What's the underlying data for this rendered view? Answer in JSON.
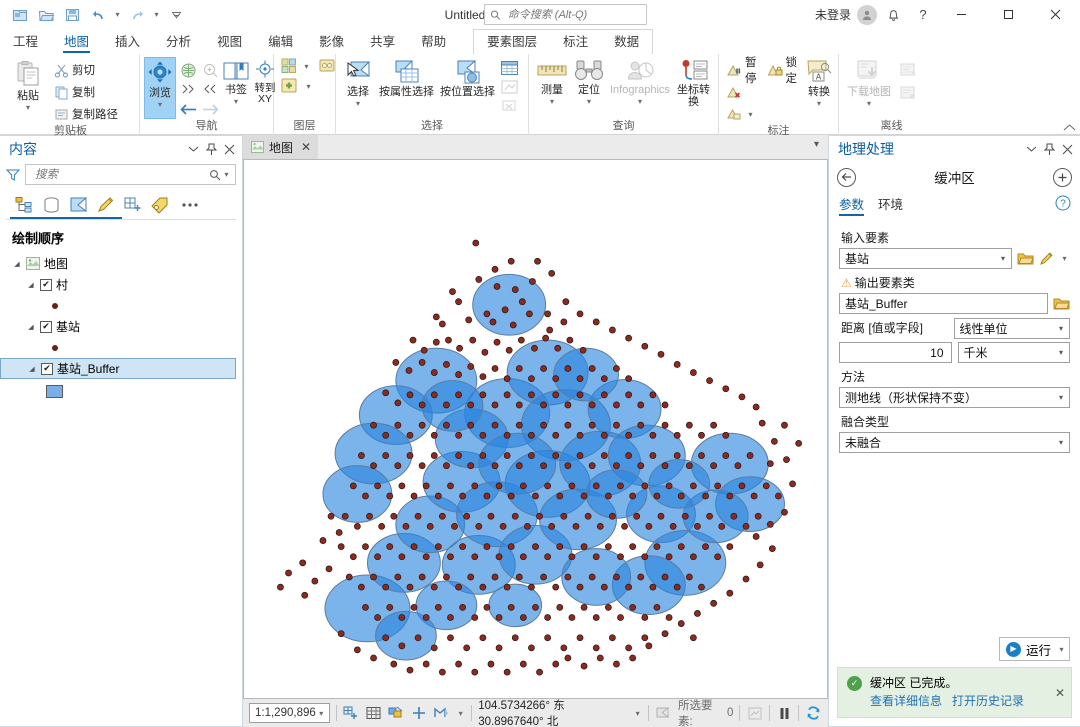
{
  "titlebar": {
    "title": "Untitled",
    "search_placeholder": "命令搜索 (Alt-Q)",
    "sign_in": "未登录",
    "qat": [
      {
        "name": "new-project-icon",
        "label": "新建"
      },
      {
        "name": "open-project-icon",
        "label": "打开"
      },
      {
        "name": "save-project-icon",
        "label": "保存"
      },
      {
        "name": "undo-icon",
        "label": "撤销"
      },
      {
        "name": "redo-icon",
        "label": "重做"
      },
      {
        "name": "customize-qat-icon",
        "label": "自定义快速访问工具栏"
      }
    ],
    "window_buttons": {
      "minimize": "—",
      "maximize": "▢",
      "close": "✕"
    },
    "help": "?"
  },
  "ribbon": {
    "tabs": [
      {
        "label": "工程",
        "active": false
      },
      {
        "label": "地图",
        "active": true
      },
      {
        "label": "插入",
        "active": false
      },
      {
        "label": "分析",
        "active": false
      },
      {
        "label": "视图",
        "active": false
      },
      {
        "label": "编辑",
        "active": false
      },
      {
        "label": "影像",
        "active": false
      },
      {
        "label": "共享",
        "active": false
      },
      {
        "label": "帮助",
        "active": false
      }
    ],
    "contextual_tabs": [
      {
        "label": "要素图层"
      },
      {
        "label": "标注"
      },
      {
        "label": "数据"
      }
    ],
    "groups": {
      "clipboard": {
        "label": "剪贴板",
        "paste": "粘贴",
        "cut": "剪切",
        "copy": "复制",
        "copy_path": "复制路径"
      },
      "navigate": {
        "label": "导航",
        "explore": "浏览",
        "bookmarks": "书签",
        "goto_xy": "转到\nXY",
        "goto_xy_line1": "转到",
        "goto_xy_line2": "XY"
      },
      "layer": {
        "label": "图层"
      },
      "selection": {
        "label": "选择",
        "select": "选择",
        "select_by_attributes": "按属性选择",
        "select_by_location": "按位置选择"
      },
      "inquiry": {
        "label": "查询",
        "measure": "测量",
        "locate": "定位",
        "infographics": "Infographics",
        "coordinate_conversion": "坐标转换"
      },
      "labeling": {
        "label": "标注",
        "pause": "暂停",
        "lock": "锁定",
        "convert": "转换"
      },
      "offline": {
        "label": "离线",
        "download_map": "下载地图"
      }
    }
  },
  "contents_pane": {
    "title": "内容",
    "search_placeholder": "搜索",
    "toolbar_icons": [
      {
        "name": "list-by-drawing-order-icon"
      },
      {
        "name": "list-by-data-source-icon"
      },
      {
        "name": "list-by-selection-icon"
      },
      {
        "name": "list-by-editing-icon"
      },
      {
        "name": "list-by-snapping-icon"
      },
      {
        "name": "list-by-labeling-icon"
      },
      {
        "name": "more-options-icon"
      }
    ],
    "heading": "绘制顺序",
    "tree": [
      {
        "label": "地图",
        "indent": 0,
        "type": "map",
        "checkbox": false,
        "expanded": true,
        "selected": false
      },
      {
        "label": "村",
        "indent": 1,
        "type": "layer",
        "checkbox": true,
        "checked": true,
        "expanded": true,
        "selected": false,
        "symbol": "point",
        "symbol_color": "#6b1f17"
      },
      {
        "label": "基站",
        "indent": 1,
        "type": "layer",
        "checkbox": true,
        "checked": true,
        "expanded": true,
        "selected": false,
        "symbol": "point",
        "symbol_color": "#6b1f17"
      },
      {
        "label": "基站_Buffer",
        "indent": 1,
        "type": "layer",
        "checkbox": true,
        "checked": true,
        "expanded": true,
        "selected": true,
        "symbol": "polygon",
        "symbol_color": "#7aaee8"
      }
    ]
  },
  "map_view": {
    "tab_label": "地图",
    "tab_close": "✕"
  },
  "statusbar": {
    "scale": "1:1,290,896",
    "coordinates": "104.5734266° 东  30.8967640° 北",
    "selected_features_label": "所选要素:",
    "selected_features_count": "0",
    "icons": [
      {
        "name": "select-by-rectangle-icon"
      },
      {
        "name": "open-attribute-table-icon"
      },
      {
        "name": "clear-selection-icon"
      },
      {
        "name": "add-xy-icon"
      },
      {
        "name": "measure-icon"
      },
      {
        "name": "selection-dropdown-icon"
      },
      {
        "name": "coordinate-dropdown-icon"
      },
      {
        "name": "selection-count-icon"
      },
      {
        "name": "drawing-status-icon"
      },
      {
        "name": "pause-drawing-icon"
      },
      {
        "name": "refresh-icon"
      }
    ]
  },
  "geoprocessing": {
    "title": "地理处理",
    "tool_name": "缓冲区",
    "back_icon": "‹",
    "add_icon": "+",
    "tabs": [
      {
        "label": "参数",
        "active": true
      },
      {
        "label": "环境",
        "active": false
      }
    ],
    "help_icon": "?",
    "fields": {
      "input_features": {
        "label": "输入要素",
        "value": "基站"
      },
      "output_feature_class": {
        "label": "输出要素类",
        "value": "基站_Buffer",
        "has_warning": true
      },
      "distance": {
        "label": "距离 [值或字段]",
        "value": "10"
      },
      "linear_unit": {
        "label": "线性单位",
        "value": "千米"
      },
      "method": {
        "label": "方法",
        "value": "测地线（形状保持不变）"
      },
      "dissolve_type": {
        "label": "融合类型",
        "value": "未融合"
      }
    },
    "run_button": "运行",
    "message": {
      "text": "缓冲区 已完成。",
      "link_details": "查看详细信息",
      "link_history": "打开历史记录",
      "close": "✕",
      "status_color": "#4fa04f",
      "background": "#e4f1e2"
    }
  },
  "map_data": {
    "buffer_fill": "#1e7fe0",
    "buffer_fill_single": "#aecbe8",
    "buffer_outline": "#5a7fa8",
    "point_fill": "#8b2a1f",
    "point_outline": "#2a1a1a",
    "background": "#ffffff"
  }
}
